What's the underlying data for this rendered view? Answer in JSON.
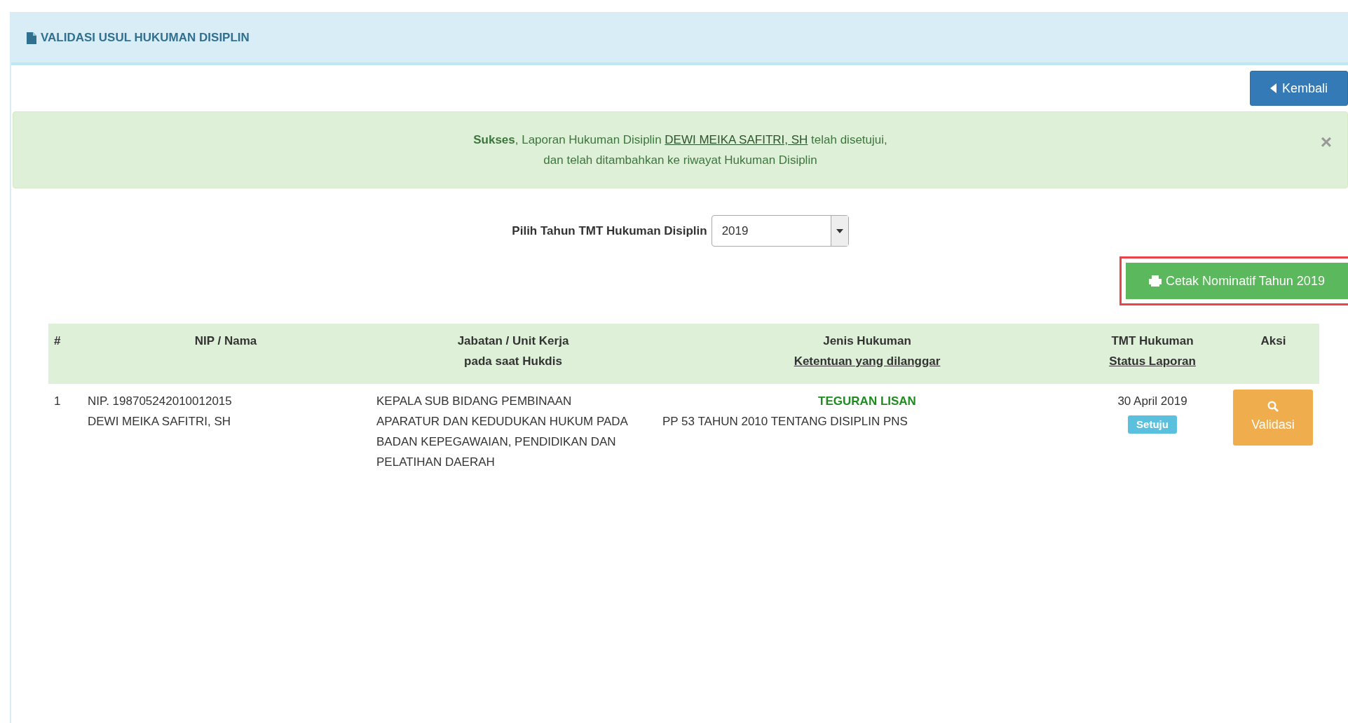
{
  "panel": {
    "title": "VALIDASI USUL HUKUMAN DISIPLIN"
  },
  "back_button": "Kembali",
  "alert": {
    "parts": [
      {
        "kind": "bold",
        "text": "Sukses"
      },
      {
        "kind": "text",
        "text": ", Laporan Hukuman Disiplin "
      },
      {
        "kind": "link",
        "text": "DEWI MEIKA SAFITRI, SH"
      },
      {
        "kind": "text",
        "text": " telah disetujui,"
      }
    ],
    "line2": "dan telah ditambahkan ke riwayat Hukuman Disiplin",
    "close": "×"
  },
  "year_filter": {
    "label": "Pilih Tahun TMT Hukuman Disiplin",
    "value": "2019"
  },
  "print_button": {
    "label": "Cetak Nominatif Tahun 2019",
    "highlighted": true
  },
  "table": {
    "columns": [
      {
        "line1": "#"
      },
      {
        "line1": "NIP / Nama"
      },
      {
        "line1": "Jabatan / Unit Kerja",
        "line2": "pada saat Hukdis"
      },
      {
        "line1": "Jenis Hukuman",
        "line2": "Ketentuan yang dilanggar",
        "underline": true
      },
      {
        "line1": "TMT Hukuman",
        "line2": "Status Laporan",
        "underline": true
      },
      {
        "line1": "Aksi"
      }
    ],
    "rows": [
      {
        "no": "1",
        "nip": "NIP. 198705242010012015",
        "name": "DEWI MEIKA SAFITRI, SH",
        "position": "KEPALA SUB BIDANG PEMBINAAN APARATUR DAN KEDUDUKAN HUKUM PADA BADAN KEPEGAWAIAN, PENDIDIKAN DAN PELATIHAN DAERAH",
        "penalty": "TEGURAN LISAN",
        "regulation": "PP 53 TAHUN 2010 TENTANG DISIPLIN PNS",
        "date": "30 April 2019",
        "status": "Setuju",
        "action": "Validasi"
      }
    ]
  }
}
